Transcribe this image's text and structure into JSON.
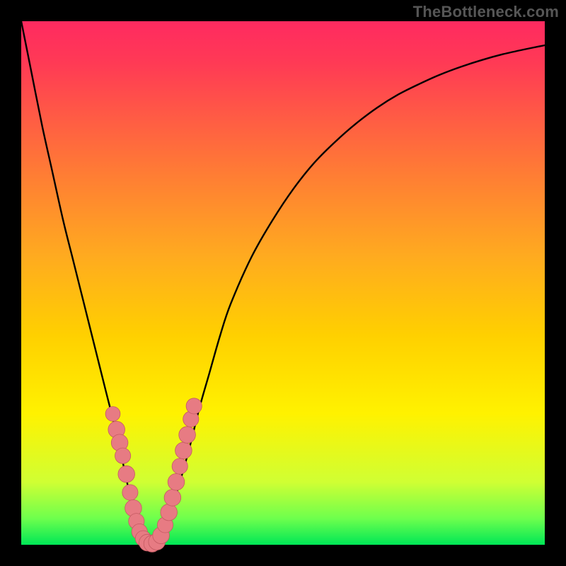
{
  "watermark": "TheBottleneck.com",
  "colors": {
    "frame": "#000000",
    "gradient_bottom": "#00e756",
    "gradient_top": "#ff2a60",
    "curve": "#000000",
    "marker_fill": "#e77b83",
    "marker_stroke": "#c45a62"
  },
  "chart_data": {
    "type": "line",
    "title": "",
    "xlabel": "",
    "ylabel": "",
    "xlim": [
      0,
      100
    ],
    "ylim": [
      0,
      100
    ],
    "grid": false,
    "series": [
      {
        "name": "bottleneck-curve",
        "x": [
          0,
          2,
          4,
          6,
          8,
          10,
          12,
          14,
          16,
          18,
          20,
          21,
          22,
          23,
          24,
          25,
          26,
          28,
          30,
          32,
          34,
          36,
          38,
          40,
          44,
          48,
          52,
          56,
          60,
          64,
          68,
          72,
          76,
          80,
          84,
          88,
          92,
          96,
          100
        ],
        "values": [
          100,
          90,
          80,
          71,
          62,
          54,
          46,
          38,
          30,
          22,
          13,
          8,
          4,
          1,
          0,
          0,
          1,
          5,
          11,
          18,
          26,
          33,
          40,
          46,
          55,
          62,
          68,
          73,
          77,
          80.5,
          83.5,
          86,
          88,
          89.8,
          91.3,
          92.6,
          93.7,
          94.6,
          95.4
        ]
      }
    ],
    "markers": [
      {
        "x": 17.5,
        "y": 25,
        "r": 1.4
      },
      {
        "x": 18.2,
        "y": 22,
        "r": 1.6
      },
      {
        "x": 18.8,
        "y": 19.5,
        "r": 1.6
      },
      {
        "x": 19.4,
        "y": 17,
        "r": 1.5
      },
      {
        "x": 20.1,
        "y": 13.5,
        "r": 1.6
      },
      {
        "x": 20.8,
        "y": 10,
        "r": 1.5
      },
      {
        "x": 21.4,
        "y": 7,
        "r": 1.6
      },
      {
        "x": 22.0,
        "y": 4.5,
        "r": 1.5
      },
      {
        "x": 22.6,
        "y": 2.5,
        "r": 1.5
      },
      {
        "x": 23.3,
        "y": 1.2,
        "r": 1.5
      },
      {
        "x": 24.1,
        "y": 0.4,
        "r": 1.6
      },
      {
        "x": 25.0,
        "y": 0.2,
        "r": 1.6
      },
      {
        "x": 25.9,
        "y": 0.6,
        "r": 1.6
      },
      {
        "x": 26.7,
        "y": 1.8,
        "r": 1.6
      },
      {
        "x": 27.5,
        "y": 3.8,
        "r": 1.5
      },
      {
        "x": 28.2,
        "y": 6.2,
        "r": 1.6
      },
      {
        "x": 28.9,
        "y": 9,
        "r": 1.6
      },
      {
        "x": 29.6,
        "y": 12,
        "r": 1.6
      },
      {
        "x": 30.3,
        "y": 15,
        "r": 1.5
      },
      {
        "x": 31.0,
        "y": 18,
        "r": 1.6
      },
      {
        "x": 31.7,
        "y": 21,
        "r": 1.6
      },
      {
        "x": 32.4,
        "y": 24,
        "r": 1.5
      },
      {
        "x": 33.0,
        "y": 26.5,
        "r": 1.5
      }
    ]
  }
}
